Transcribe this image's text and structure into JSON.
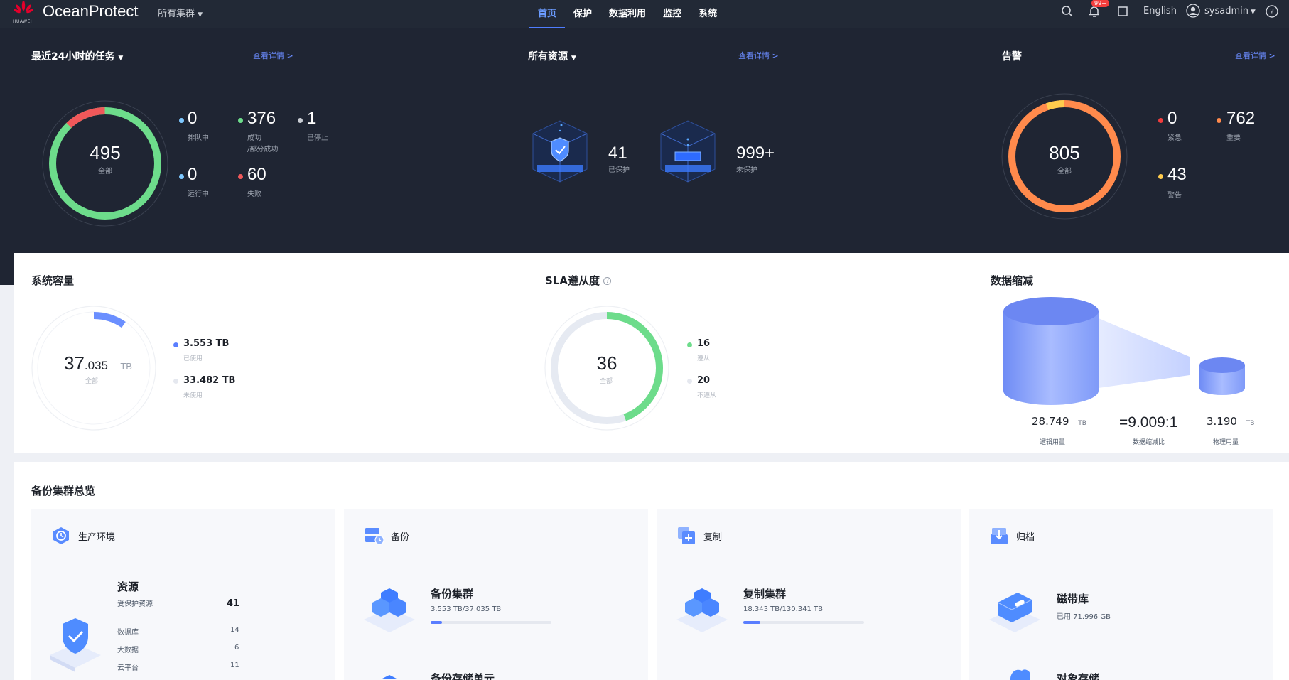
{
  "header": {
    "logo_text": "HUAWEI",
    "app_title": "OceanProtect",
    "cluster_label": "所有集群",
    "nav": [
      "首页",
      "保护",
      "数据利用",
      "监控",
      "系统"
    ],
    "notification_badge": "99+",
    "language": "English",
    "user": "sysadmin"
  },
  "tasks": {
    "title": "最近24小时的任务",
    "link": "查看详情 >",
    "total": "495",
    "total_label": "全部",
    "queued": "0",
    "queued_label": "排队中",
    "success": "376",
    "success_label1": "成功",
    "success_label2": "/部分成功",
    "stopped": "1",
    "stopped_label": "已停止",
    "running": "0",
    "running_label": "运行中",
    "failed": "60",
    "failed_label": "失败"
  },
  "resources": {
    "title": "所有资源",
    "link": "查看详情 >",
    "protected": "41",
    "protected_label": "已保护",
    "unprotected": "999+",
    "unprotected_label": "未保护"
  },
  "alarms": {
    "title": "告警",
    "link": "查看详情 >",
    "total": "805",
    "total_label": "全部",
    "critical": "0",
    "critical_label": "紧急",
    "major": "762",
    "major_label": "重要",
    "warning": "43",
    "warning_label": "警告"
  },
  "capacity": {
    "title": "系统容量",
    "total_int": "37",
    "total_dec": ".035",
    "unit": "TB",
    "total_label": "全部",
    "used": "3.553 TB",
    "used_label": "已使用",
    "unused": "33.482 TB",
    "unused_label": "未使用",
    "used_fraction": 0.096
  },
  "sla": {
    "title": "SLA遵从度",
    "total": "36",
    "total_label": "全部",
    "compliant": "16",
    "compliant_label": "遵从",
    "noncompliant": "20",
    "noncompliant_label": "不遵从"
  },
  "reduction": {
    "title": "数据缩减",
    "logical": "28.749",
    "logical_unit": "TB",
    "logical_label": "逻辑用量",
    "ratio": "=9.009:1",
    "ratio_label": "数据缩减比",
    "physical": "3.190",
    "physical_unit": "TB",
    "physical_label": "物理用量"
  },
  "overview": {
    "title": "备份集群总览",
    "production": {
      "label": "生产环境",
      "heading": "资源",
      "protected_label": "受保护资源",
      "protected_value": "41",
      "rows": [
        {
          "name": "数据库",
          "value": "14"
        },
        {
          "name": "大数据",
          "value": "6"
        },
        {
          "name": "云平台",
          "value": "11"
        }
      ]
    },
    "backup": {
      "label": "备份",
      "heading": "备份集群",
      "usage": "3.553 TB/37.035 TB",
      "usage_fraction": 0.096,
      "next_heading": "备份存储单元"
    },
    "replication": {
      "label": "复制",
      "heading": "复制集群",
      "usage": "18.343 TB/130.341 TB",
      "usage_fraction": 0.141
    },
    "archive": {
      "label": "归档",
      "heading": "磁带库",
      "usage": "已用 71.996 GB",
      "next_heading": "对象存储"
    }
  },
  "colors": {
    "success": "#6ddc8b",
    "failed": "#f0585a",
    "queued": "#7ec8ff",
    "stopped": "#c9cdd4",
    "major": "#ff8a4c",
    "warning": "#ffcc4d",
    "critical": "#f23d3d",
    "accent": "#5a7eff"
  }
}
